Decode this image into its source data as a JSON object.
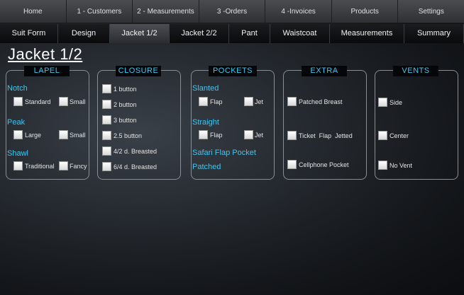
{
  "topnav": [
    "Home",
    "1 - Customers",
    "2 - Measurements",
    "3 -Orders",
    "4 -Invoices",
    "Products",
    "Settings"
  ],
  "subtabs": [
    "Suit Form",
    "Design",
    "Jacket 1/2",
    "Jacket 2/2",
    "Pant",
    "Waistcoat",
    "Measurements",
    "Summary"
  ],
  "active_subtab": "Jacket 1/2",
  "page_title": "Jacket 1/2",
  "lapel": {
    "title": "LAPEL",
    "notch": {
      "label": "Notch",
      "opt1": "Standard",
      "opt2": "Small"
    },
    "peak": {
      "label": "Peak",
      "opt1": "Large",
      "opt2": "Small"
    },
    "shawl": {
      "label": "Shawl",
      "opt1": "Traditional",
      "opt2": "Fancy"
    }
  },
  "closure": {
    "title": "CLOSURE",
    "options": [
      "1 button",
      "2 button",
      "3 button",
      "2.5 button",
      "4/2 d. Breasted",
      "6/4 d. Breasted"
    ]
  },
  "pockets": {
    "title": "POCKETS",
    "slanted": {
      "label": "Slanted",
      "opt1": "Flap",
      "opt2": "Jet"
    },
    "straight": {
      "label": "Straight",
      "opt1": "Flap",
      "opt2": "Jet"
    },
    "safari": "Safari Flap Pocket",
    "patched": "Patched"
  },
  "extra": {
    "title": "EXTRA",
    "options": [
      "Patched Breast",
      "Ticket  Flap  Jetted",
      "Cellphone Pocket"
    ]
  },
  "vents": {
    "title": "VENTS",
    "options": [
      "Side",
      "Center",
      "No Vent"
    ]
  },
  "colors": {
    "accent": "#3ec6f0",
    "active_tab": "#3a3d42"
  }
}
